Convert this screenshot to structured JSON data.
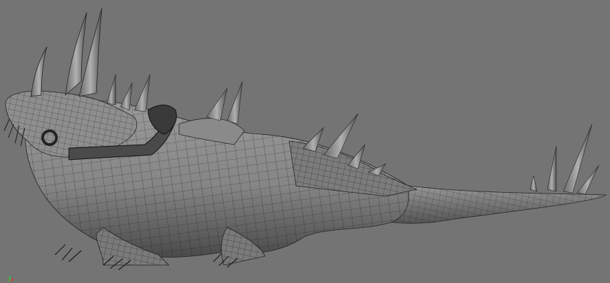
{
  "viewport": {
    "background_color": "#747474",
    "model_fill": "#8a8a8a",
    "model_shadow": "#3d3d3d",
    "wire_color": "#1a1a1a",
    "view_mode": "wireframe-on-shaded",
    "subject": "creature-model"
  },
  "gizmo": {
    "icon": "axis-gizmo-icon",
    "x_color": "#e03030",
    "y_color": "#30d030"
  }
}
